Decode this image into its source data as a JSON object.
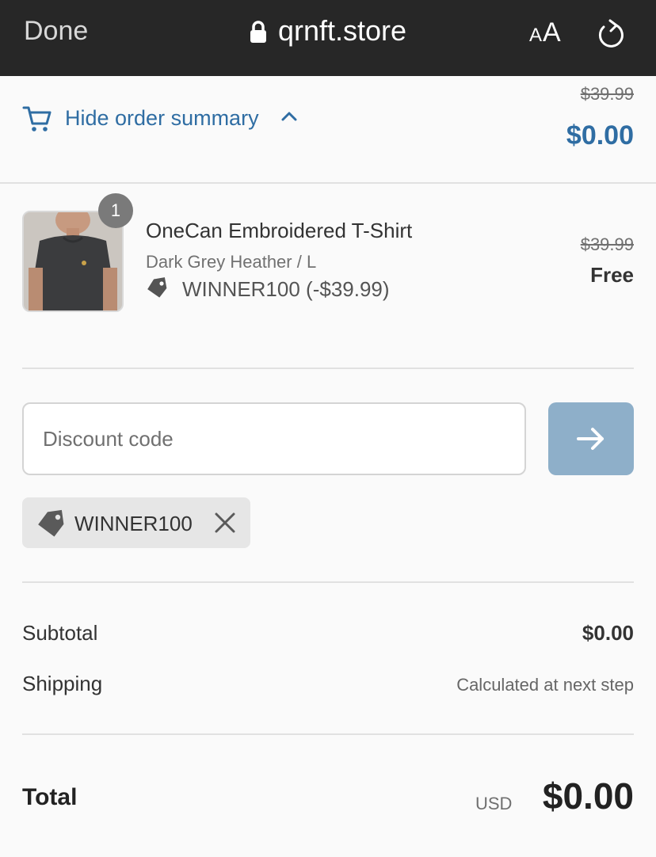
{
  "browser": {
    "done_label": "Done",
    "url": "qrnft.store",
    "text_size_label_small": "A",
    "text_size_label_large": "A"
  },
  "summary_toggle": {
    "label": "Hide order summary",
    "original_total": "$39.99",
    "total": "$0.00",
    "accent_color": "#2f6da3"
  },
  "line_item": {
    "quantity": "1",
    "title": "OneCan Embroidered T-Shirt",
    "variant": "Dark Grey Heather / L",
    "discount": "WINNER100 (-$39.99)",
    "original_price": "$39.99",
    "price": "Free"
  },
  "discount": {
    "placeholder": "Discount code",
    "applied_code": "WINNER100",
    "apply_button_color": "#8eafc9"
  },
  "totals": {
    "subtotal_label": "Subtotal",
    "subtotal_value": "$0.00",
    "shipping_label": "Shipping",
    "shipping_value": "Calculated at next step",
    "total_label": "Total",
    "currency": "USD",
    "total_value": "$0.00"
  }
}
